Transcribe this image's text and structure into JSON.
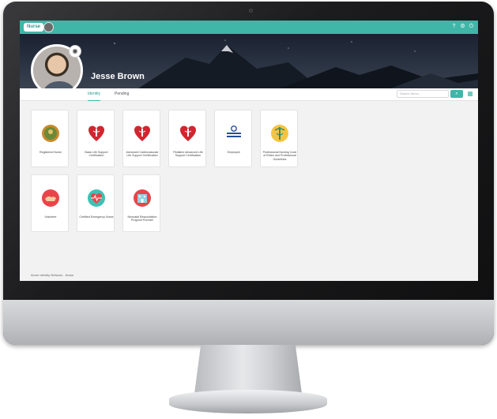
{
  "app": {
    "brand_label": "Nurse",
    "top_icons": [
      "help-icon",
      "settings-icon",
      "power-icon"
    ]
  },
  "profile": {
    "name": "Jesse Brown"
  },
  "tabs": [
    {
      "label": "Identity",
      "active": true
    },
    {
      "label": "Pending",
      "active": false
    }
  ],
  "search": {
    "placeholder": "Search Items..."
  },
  "cards": [
    {
      "label": "Registered Nurse",
      "icon": "state-seal-icon"
    },
    {
      "label": "Basic Life Support Certification",
      "icon": "aha-heart-icon"
    },
    {
      "label": "Advanced Cardiovascular Life Support Certification",
      "icon": "aha-heart-icon"
    },
    {
      "label": "Pediatric Advanced Life Support Certification",
      "icon": "aha-heart-icon"
    },
    {
      "label": "Employee",
      "icon": "university-health-system-icon"
    },
    {
      "label": "Professional Nursing Code of Ethics and Professional Guidelines",
      "icon": "nursing-caduceus-icon"
    },
    {
      "label": "Volunteer",
      "icon": "volunteer-hands-icon"
    },
    {
      "label": "Certified Emergency Nurse",
      "icon": "heartbeat-icon"
    },
    {
      "label": "Neonatal Resuscitation Program Provider",
      "icon": "hospital-icon"
    }
  ],
  "footer": {
    "text": "Acme Identity Network - Nurse"
  },
  "colors": {
    "accent": "#3fb6a8",
    "heart_red": "#d1262f"
  }
}
